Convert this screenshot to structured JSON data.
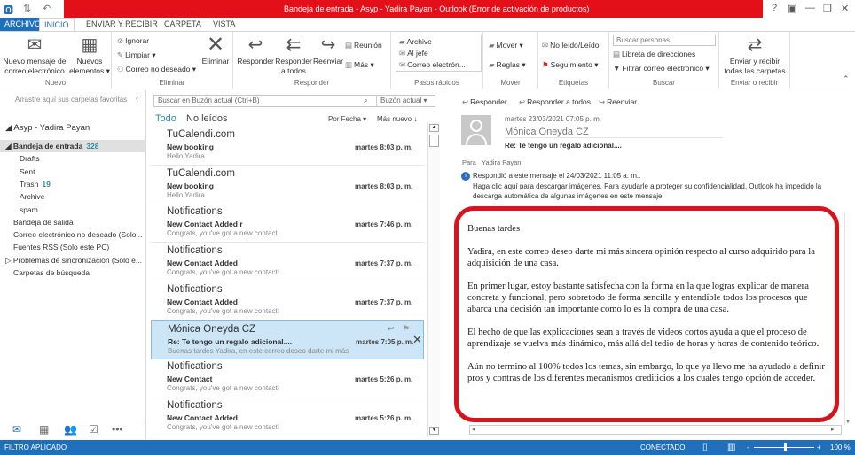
{
  "window": {
    "title": "Bandeja de entrada - Asyp - Yadira Payan -  Outlook (Error de activación de productos)",
    "controls": [
      "?",
      "▣",
      "—",
      "❐",
      "✕"
    ]
  },
  "tabs": [
    "ARCHIVO",
    "INICIO",
    "ENVIAR Y RECIBIR",
    "CARPETA",
    "VISTA"
  ],
  "ribbon": {
    "nuevo": {
      "label": "Nuevo",
      "new_mail": "Nuevo mensaje de correo electrónico",
      "new_items": "Nuevos elementos ▾"
    },
    "eliminar": {
      "label": "Eliminar",
      "ignore": "Ignorar",
      "clean": "Limpiar ▾",
      "junk": "Correo no deseado ▾",
      "delete": "Eliminar"
    },
    "responder": {
      "label": "Responder",
      "reply": "Responder",
      "reply_all": "Responder a todos",
      "forward": "Reenviar",
      "meeting": "Reunión",
      "more": "Más ▾"
    },
    "pasos": {
      "label": "Pasos rápidos",
      "items": [
        "Archive",
        "Al jefe",
        "Correo electrón..."
      ]
    },
    "mover": {
      "label": "Mover",
      "move": "Mover ▾",
      "rules": "Reglas ▾"
    },
    "etiquetas": {
      "label": "Etiquetas",
      "unread": "No leído/Leído",
      "followup": "Seguimiento ▾"
    },
    "buscar": {
      "label": "Buscar",
      "placeholder": "Buscar personas",
      "address_book": "Libreta de direcciones",
      "filter": "Filtrar correo electrónico ▾"
    },
    "enviar": {
      "label": "Enviar o recibir",
      "send_all": "Enviar y recibir todas las carpetas"
    }
  },
  "sidebar": {
    "favorites_hint": "Arrastre aquí sus carpetas favoritas",
    "account": "◢ Asyp - Yadira Payan",
    "folders": [
      {
        "name": "◢ Bandeja de entrada",
        "count": "328",
        "bold": true,
        "indent": 1
      },
      {
        "name": "Drafts",
        "indent": 2
      },
      {
        "name": "Sent",
        "indent": 2
      },
      {
        "name": "Trash",
        "count": "19",
        "indent": 2
      },
      {
        "name": "Archive",
        "indent": 2
      },
      {
        "name": "spam",
        "indent": 2
      },
      {
        "name": "Bandeja de salida",
        "indent": 1
      },
      {
        "name": "Correo electrónico no deseado (Solo...",
        "indent": 1
      },
      {
        "name": "Fuentes RSS (Solo este PC)",
        "indent": 1
      },
      {
        "name": "▷ Problemas de sincronización (Solo e...",
        "indent": 0
      },
      {
        "name": "Carpetas de búsqueda",
        "indent": 1
      }
    ]
  },
  "list": {
    "search_placeholder": "Buscar en Buzón actual (Ctrl+B)",
    "scope": "Buzón actual",
    "filter_all": "Todo",
    "filter_unread": "No leídos",
    "sort": "Por Fecha ▾",
    "order": "Más nuevo ↓",
    "items": [
      {
        "from": "TuCalendi.com",
        "subject": "New booking",
        "preview": "Hello Yadira",
        "date": "martes 8:03 p. m."
      },
      {
        "from": "TuCalendi.com",
        "subject": "New booking",
        "preview": "Hello Yadira",
        "date": "martes 8:03 p. m."
      },
      {
        "from": "Notifications",
        "subject": "New Contact Added r",
        "preview": "Congrats, you've got a new contact",
        "date": "martes 7:46 p. m."
      },
      {
        "from": "Notifications",
        "subject": "New Contact Added",
        "preview": "Congrats, you've got a new contact!",
        "date": "martes 7:37 p. m."
      },
      {
        "from": "Notifications",
        "subject": "New Contact Added",
        "preview": "Congrats, you've got a new contact!",
        "date": "martes 7:37 p. m."
      },
      {
        "from": "Mónica Oneyda CZ",
        "subject": "Re: Te tengo un regalo adicional....",
        "preview": "Buenas tardes   Yadira, en este correo deseo darte mi más",
        "date": "martes 7:05 p. m.",
        "selected": true
      },
      {
        "from": "Notifications",
        "subject": "New Contact",
        "preview": "Congrats, you've got a new contact!",
        "date": "martes 5:26 p. m."
      },
      {
        "from": "Notifications",
        "subject": "New Contact Added",
        "preview": "Congrats, you've got a new contact!",
        "date": "martes 5:26 p. m."
      }
    ]
  },
  "reading": {
    "actions": [
      "Responder",
      "Responder a todos",
      "Reenviar"
    ],
    "datetime": "martes 23/03/2021 07:05 p. m.",
    "sender": "Mónica Oneyda CZ",
    "subject": "Re: Te tengo un regalo adicional....",
    "to_label": "Para",
    "to": "Yadira Payan",
    "info1": "Respondió a este mensaje el 24/03/2021 11:05 a. m..",
    "info2": "Haga clic aquí para descargar imágenes. Para ayudarle a proteger su confidencialidad, Outlook ha impedido la descarga automática de algunas imágenes en este mensaje.",
    "body": [
      "Buenas tardes",
      "Yadira, en este correo deseo darte mi más sincera opinión respecto al curso adquirido para la adquisición de una casa.",
      "En primer lugar, estoy bastante satisfecha con la forma en la que logras explicar de manera concreta y funcional, pero sobretodo de forma sencilla y entendible todos los procesos que abarca una decisión tan importante como lo es la compra de una casa.",
      "El hecho de que las explicaciones sean a través de videos cortos ayuda  a que el proceso de aprendizaje se vuelva más dinámico, más allá del tedio de horas y horas de contenido teórico.",
      "Aún no termino al 100% todos los temas, sin embargo, lo que ya llevo me ha ayudado a definir pros y contras de los diferentes mecanismos crediticios a los cuales tengo opción de acceder."
    ],
    "highlight_color": "#d7141e"
  },
  "status": {
    "left": "FILTRO APLICADO",
    "connected": "CONECTADO",
    "zoom": "100 %",
    "zoom_percent": 100
  },
  "colors": {
    "accent": "#1f6fba",
    "title_bar": "#e3101a",
    "selected_row": "#cde6f7"
  }
}
